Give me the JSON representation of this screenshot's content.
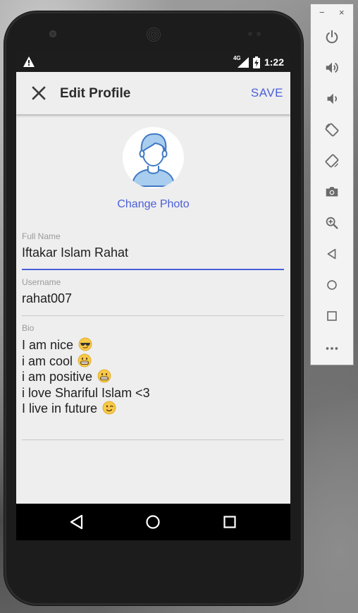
{
  "status_bar": {
    "network": "4G",
    "time": "1:22"
  },
  "app_bar": {
    "title": "Edit Profile",
    "save_label": "SAVE"
  },
  "profile": {
    "change_photo_label": "Change Photo",
    "full_name": {
      "label": "Full Name",
      "value": "Iftakar Islam Rahat"
    },
    "username": {
      "label": "Username",
      "value": "rahat007"
    },
    "bio": {
      "label": "Bio",
      "lines": [
        {
          "text": "I am nice",
          "emoji": "sunglasses-emoji"
        },
        {
          "text": "i am cool",
          "emoji": "grin-emoji"
        },
        {
          "text": "i am positive",
          "emoji": "grin-emoji"
        },
        {
          "text": "i love Shariful Islam <3",
          "emoji": ""
        },
        {
          "text": "I live in future",
          "emoji": "wink-emoji"
        }
      ]
    }
  },
  "colors": {
    "accent": "#4a5ed9",
    "screen_bg": "#eeeeee",
    "status_bar": "#1d1d1d"
  },
  "emulator_toolbar": {
    "window_controls": {
      "minimize": "−",
      "close": "×"
    },
    "buttons": [
      "power-icon",
      "volume-up-icon",
      "volume-down-icon",
      "rotate-left-icon",
      "rotate-right-icon",
      "camera-icon",
      "zoom-icon",
      "back-icon",
      "home-icon",
      "overview-icon",
      "more-icon"
    ]
  }
}
